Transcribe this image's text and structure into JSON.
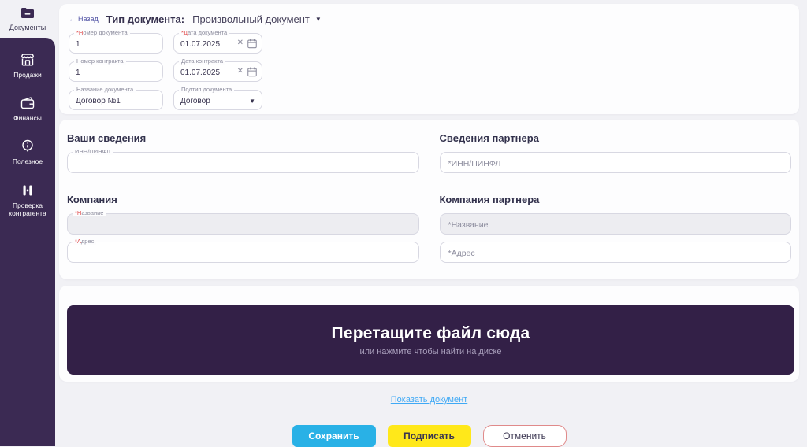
{
  "sidebar": {
    "items": [
      {
        "label": "Документы",
        "icon": "documents-folder-icon",
        "active": true
      },
      {
        "label": "Продажи",
        "icon": "sales-store-icon",
        "active": false
      },
      {
        "label": "Финансы",
        "icon": "finance-wallet-icon",
        "active": false
      },
      {
        "label": "Полезное",
        "icon": "useful-info-icon",
        "active": false
      },
      {
        "label": "Проверка контрагента",
        "icon": "counterparty-check-icon",
        "active": false
      }
    ]
  },
  "header": {
    "back_label": "Назад",
    "type_label": "Тип документа:",
    "type_value": "Произвольный документ"
  },
  "doc_form": {
    "doc_number": {
      "label": "*Номер документа",
      "value": "1"
    },
    "doc_date": {
      "label": "*Дата документа",
      "value": "01.07.2025"
    },
    "contract_number": {
      "label": "Номер контракта",
      "value": "1"
    },
    "contract_date": {
      "label": "Дата контракта",
      "value": "01.07.2025"
    },
    "doc_name": {
      "label": "Название документа",
      "value": "Договор №1"
    },
    "doc_subtype": {
      "label": "Подтип документа",
      "value": "Договор"
    }
  },
  "details": {
    "your_info_title": "Ваши сведения",
    "your_inn_label": "ИНН/ПИНФЛ",
    "partner_info_title": "Сведения партнера",
    "partner_inn_placeholder": "*ИНН/ПИНФЛ",
    "company_title": "Компания",
    "company_name_label": "*Название",
    "company_address_label": "*Адрес",
    "partner_company_title": "Компания партнера",
    "partner_name_placeholder": "*Название",
    "partner_address_placeholder": "*Адрес"
  },
  "dropzone": {
    "title": "Перетащите файл сюда",
    "subtitle": "или нажмите чтобы найти на диске"
  },
  "footer": {
    "show_document_link": "Показать документ",
    "save_label": "Сохранить",
    "sign_label": "Подписать",
    "cancel_label": "Отменить"
  },
  "icons": {
    "back_arrow": "←",
    "caret_down": "▼",
    "select_caret": "▼",
    "clear_x": "✕"
  },
  "colors": {
    "sidebar_purple": "#3b2a53",
    "dropzone_purple": "#332047",
    "save_blue": "#29b1e6",
    "sign_yellow": "#ffe81a",
    "cancel_border_red": "#e08a8a",
    "link_blue": "#3fa9f5"
  }
}
